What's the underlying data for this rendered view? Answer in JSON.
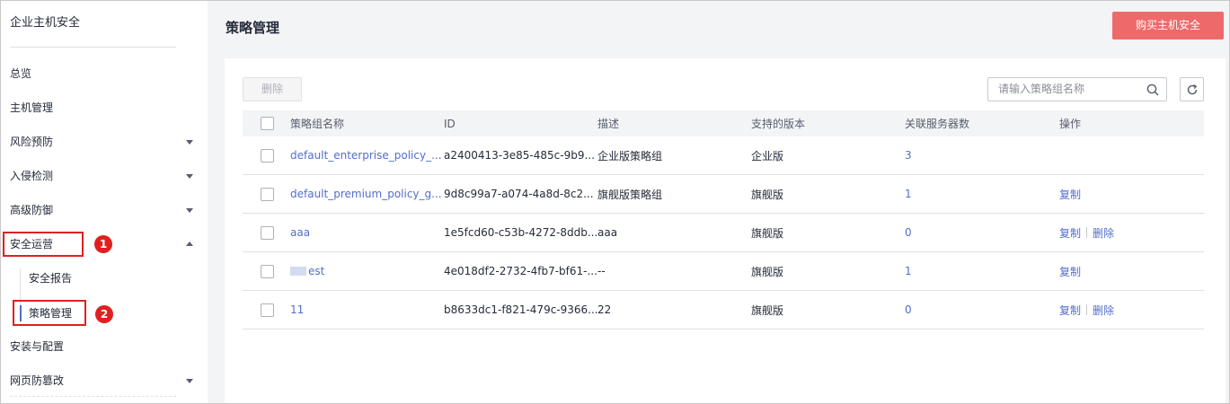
{
  "sidebar": {
    "title": "企业主机安全",
    "items": [
      {
        "label": "总览"
      },
      {
        "label": "主机管理"
      },
      {
        "label": "风险预防"
      },
      {
        "label": "入侵检测"
      },
      {
        "label": "高级防御"
      },
      {
        "label": "安全运营"
      },
      {
        "label": "安全报告"
      },
      {
        "label": "策略管理"
      },
      {
        "label": "安装与配置"
      },
      {
        "label": "网页防篡改"
      }
    ],
    "badges": [
      "1",
      "2"
    ]
  },
  "header": {
    "title": "策略管理",
    "buy_button": "购买主机安全"
  },
  "toolbar": {
    "delete_label": "删除",
    "search_placeholder": "请输入策略组名称"
  },
  "table": {
    "columns": [
      "策略组名称",
      "ID",
      "描述",
      "支持的版本",
      "关联服务器数",
      "操作"
    ],
    "rows": [
      {
        "name": "default_enterprise_policy_...",
        "id": "a2400413-3e85-485c-9b9...",
        "desc": "企业版策略组",
        "version": "企业版",
        "servers": "3",
        "actions": []
      },
      {
        "name": "default_premium_policy_g...",
        "id": "9d8c99a7-a074-4a8d-8c2...",
        "desc": "旗舰版策略组",
        "version": "旗舰版",
        "servers": "1",
        "actions": [
          "复制"
        ]
      },
      {
        "name": "aaa",
        "id": "1e5fcd60-c53b-4272-8ddb...",
        "desc": "aaa",
        "version": "旗舰版",
        "servers": "0",
        "actions": [
          "复制",
          "删除"
        ]
      },
      {
        "name": "est",
        "id": "4e018df2-2732-4fb7-bf61-...",
        "desc": "--",
        "version": "旗舰版",
        "servers": "1",
        "actions": [
          "复制"
        ]
      },
      {
        "name": "11",
        "id": "b8633dc1-f821-479c-9366...",
        "desc": "22",
        "version": "旗舰版",
        "servers": "0",
        "actions": [
          "复制",
          "删除"
        ]
      }
    ]
  },
  "colors": {
    "accent": "#526ecc",
    "buy_button": "#ee6a6a",
    "highlight": "#e02020"
  }
}
